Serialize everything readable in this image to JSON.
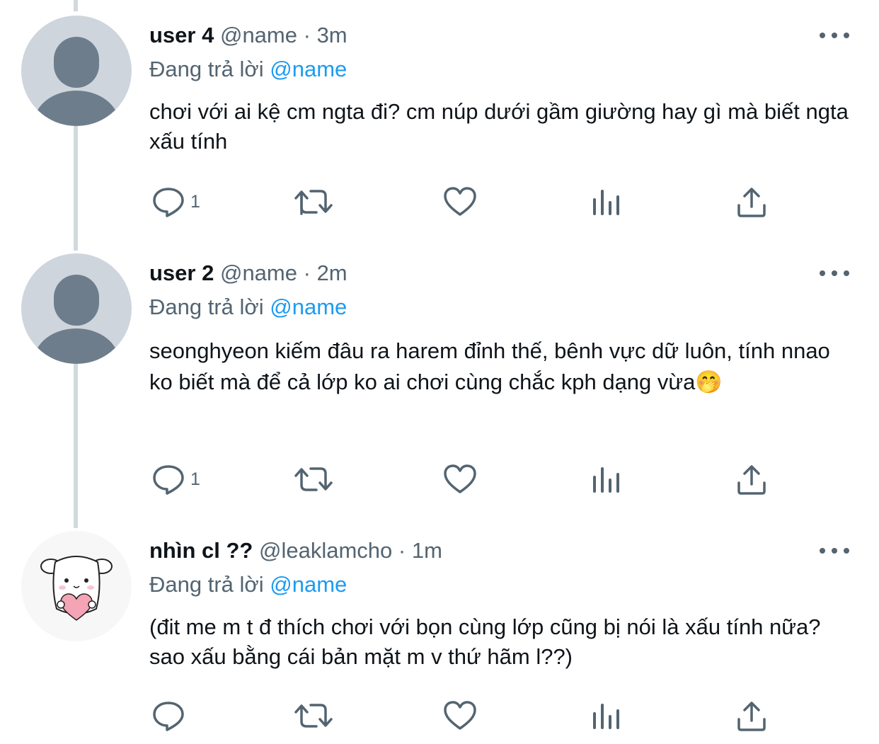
{
  "tweets": [
    {
      "name": "user 4",
      "handle": "@name",
      "sep": "·",
      "time": "3m",
      "reply_prefix": "Đang trả lời",
      "reply_to": "@name",
      "text": "chơi với ai kệ cm ngta đi? cm núp dưới gầm giường hay gì mà biết ngta xấu tính",
      "reply_count": "1",
      "avatar": "default-avatar"
    },
    {
      "name": "user 2",
      "handle": "@name",
      "sep": "·",
      "time": "2m",
      "reply_prefix": "Đang trả lời",
      "reply_to": "@name",
      "text": "seonghyeon kiếm đâu ra harem đỉnh thế, bênh vực dữ luôn, tính nnao ko biết mà để cả lớp ko ai chơi cùng chắc kph dạng vừa🤭",
      "reply_count": "1",
      "avatar": "default-avatar"
    },
    {
      "name": "nhìn cl ??",
      "handle": "@leaklamcho",
      "sep": "·",
      "time": "1m",
      "reply_prefix": "Đang trả lời",
      "reply_to": "@name",
      "text": "(đit me m t đ thích chơi với bọn cùng lớp cũng bị nói là xấu tính nữa? sao xấu bằng cái bản mặt m v thứ hãm l??)",
      "reply_count": "",
      "avatar": "puppy-heart-avatar"
    }
  ],
  "icons": {
    "reply": "reply-icon",
    "retweet": "retweet-icon",
    "like": "heart-icon",
    "analytics": "analytics-icon",
    "share": "share-icon",
    "more": "more-icon"
  },
  "colors": {
    "link": "#1d9bf0",
    "secondary": "#536471",
    "thread_line": "#cfd9de",
    "avatar_bg": "#ced5dc",
    "avatar_figure": "#6e7d8c"
  }
}
